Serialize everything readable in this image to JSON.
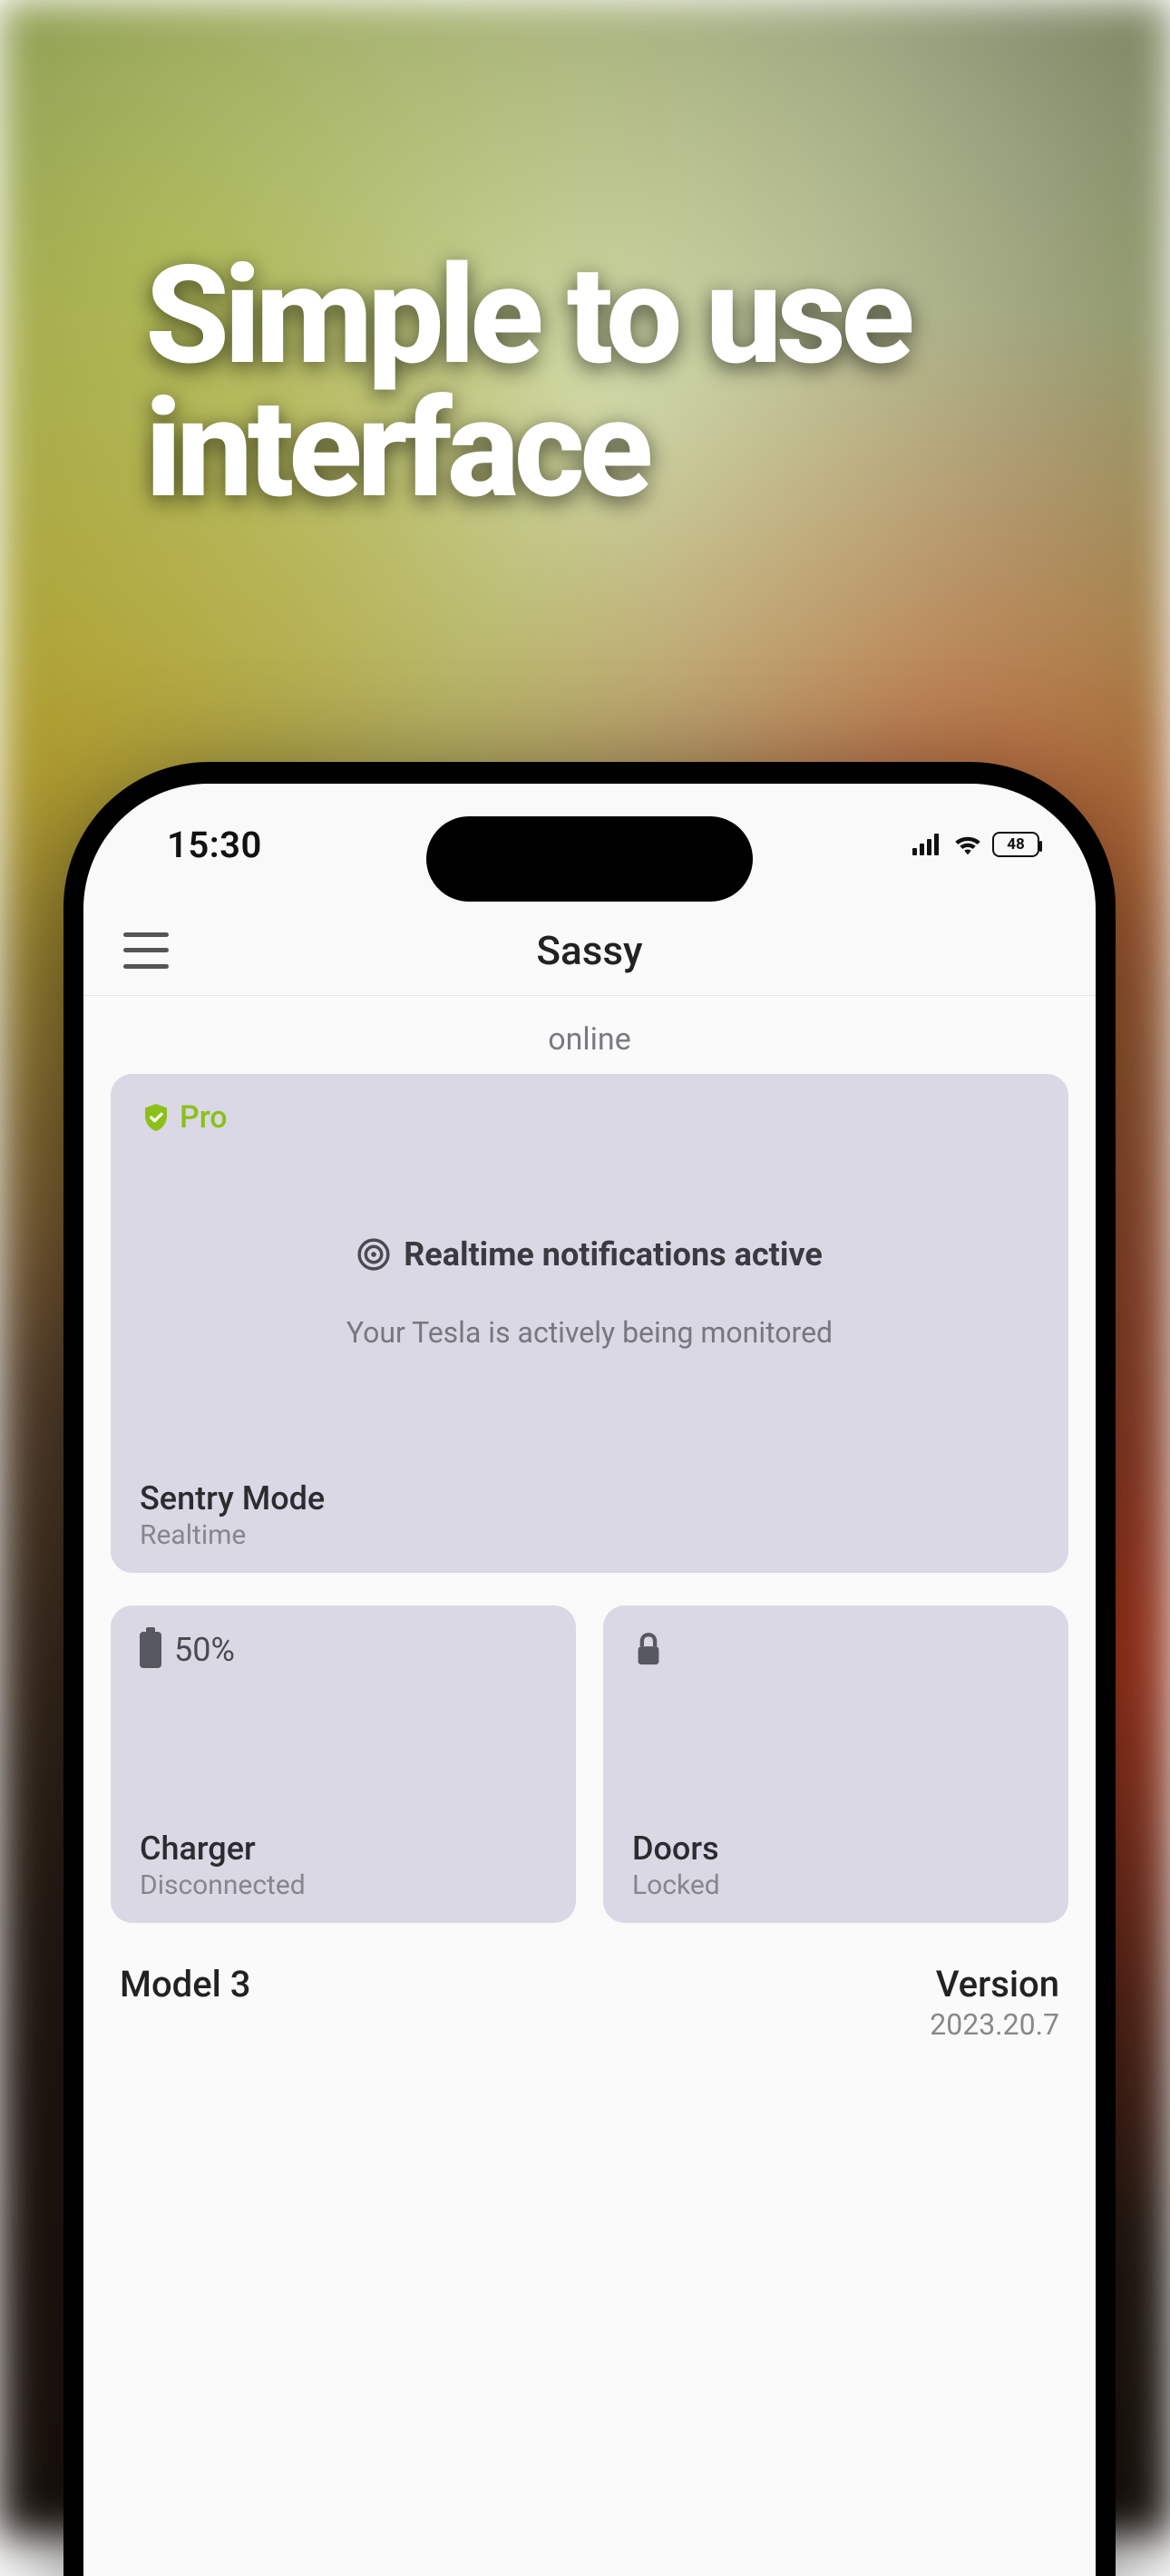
{
  "headline": {
    "line1": "Simple to use",
    "line2": "interface"
  },
  "status_bar": {
    "time": "15:30",
    "battery_pct": "48"
  },
  "header": {
    "title": "Sassy"
  },
  "online_status": "online",
  "sentry_card": {
    "pro_label": "Pro",
    "title": "Realtime notifications active",
    "subtitle": "Your Tesla is actively being monitored",
    "footer_label": "Sentry Mode",
    "footer_sub": "Realtime"
  },
  "charger_card": {
    "battery_text": "50%",
    "label": "Charger",
    "sub": "Disconnected"
  },
  "doors_card": {
    "label": "Doors",
    "sub": "Locked"
  },
  "info": {
    "model": "Model 3",
    "version_label": "Version",
    "version_value": "2023.20.7"
  }
}
